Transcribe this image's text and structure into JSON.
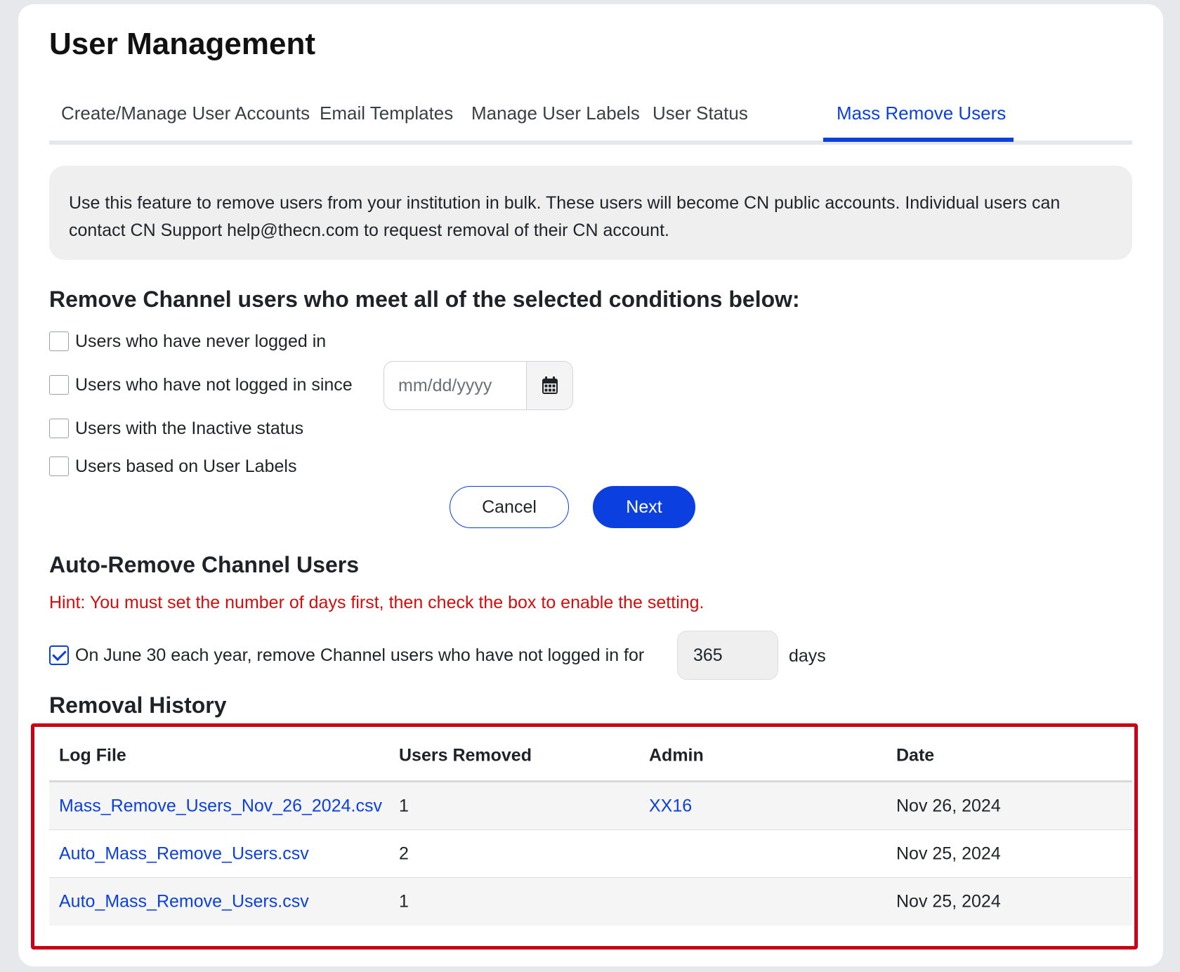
{
  "page": {
    "title": "User Management"
  },
  "tabs": [
    {
      "label": "Create/Manage User Accounts",
      "active": false
    },
    {
      "label": "Email Templates",
      "active": false
    },
    {
      "label": "Manage User Labels",
      "active": false
    },
    {
      "label": "User Status",
      "active": false
    },
    {
      "label": "Mass Remove Users",
      "active": true
    }
  ],
  "info": {
    "text": "Use this feature to remove users from your institution in bulk. These users will become CN public accounts. Individual users can contact CN Support help@thecn.com to request removal of their CN account."
  },
  "conditions": {
    "heading": "Remove Channel users who meet all of the selected conditions below:",
    "items": [
      {
        "label": "Users who have never logged in",
        "checked": false
      },
      {
        "label": "Users who have not logged in since",
        "checked": false
      },
      {
        "label": "Users with the Inactive status",
        "checked": false
      },
      {
        "label": "Users based on User Labels",
        "checked": false
      }
    ],
    "date_placeholder": "mm/dd/yyyy",
    "date_icon": "calendar-icon",
    "cancel_label": "Cancel",
    "next_label": "Next"
  },
  "auto_remove": {
    "heading": "Auto-Remove Channel Users",
    "hint": "Hint: You must set the number of days first, then check the box to enable the setting.",
    "label": "On June 30 each year, remove Channel users who have not logged in for",
    "checked": true,
    "days_value": "365",
    "days_suffix": "days"
  },
  "history": {
    "heading": "Removal History",
    "columns": [
      "Log File",
      "Users Removed",
      "Admin",
      "Date"
    ],
    "rows": [
      {
        "log_file": "Mass_Remove_Users_Nov_26_2024.csv",
        "users_removed": "1",
        "admin": "XX16",
        "date": "Nov 26, 2024"
      },
      {
        "log_file": "Auto_Mass_Remove_Users.csv",
        "users_removed": "2",
        "admin": "",
        "date": "Nov 25, 2024"
      },
      {
        "log_file": "Auto_Mass_Remove_Users.csv",
        "users_removed": "1",
        "admin": "",
        "date": "Nov 25, 2024"
      }
    ]
  },
  "colors": {
    "accent": "#0b3fe0",
    "hint": "#d10e0e",
    "highlight_border": "#cc0014"
  }
}
